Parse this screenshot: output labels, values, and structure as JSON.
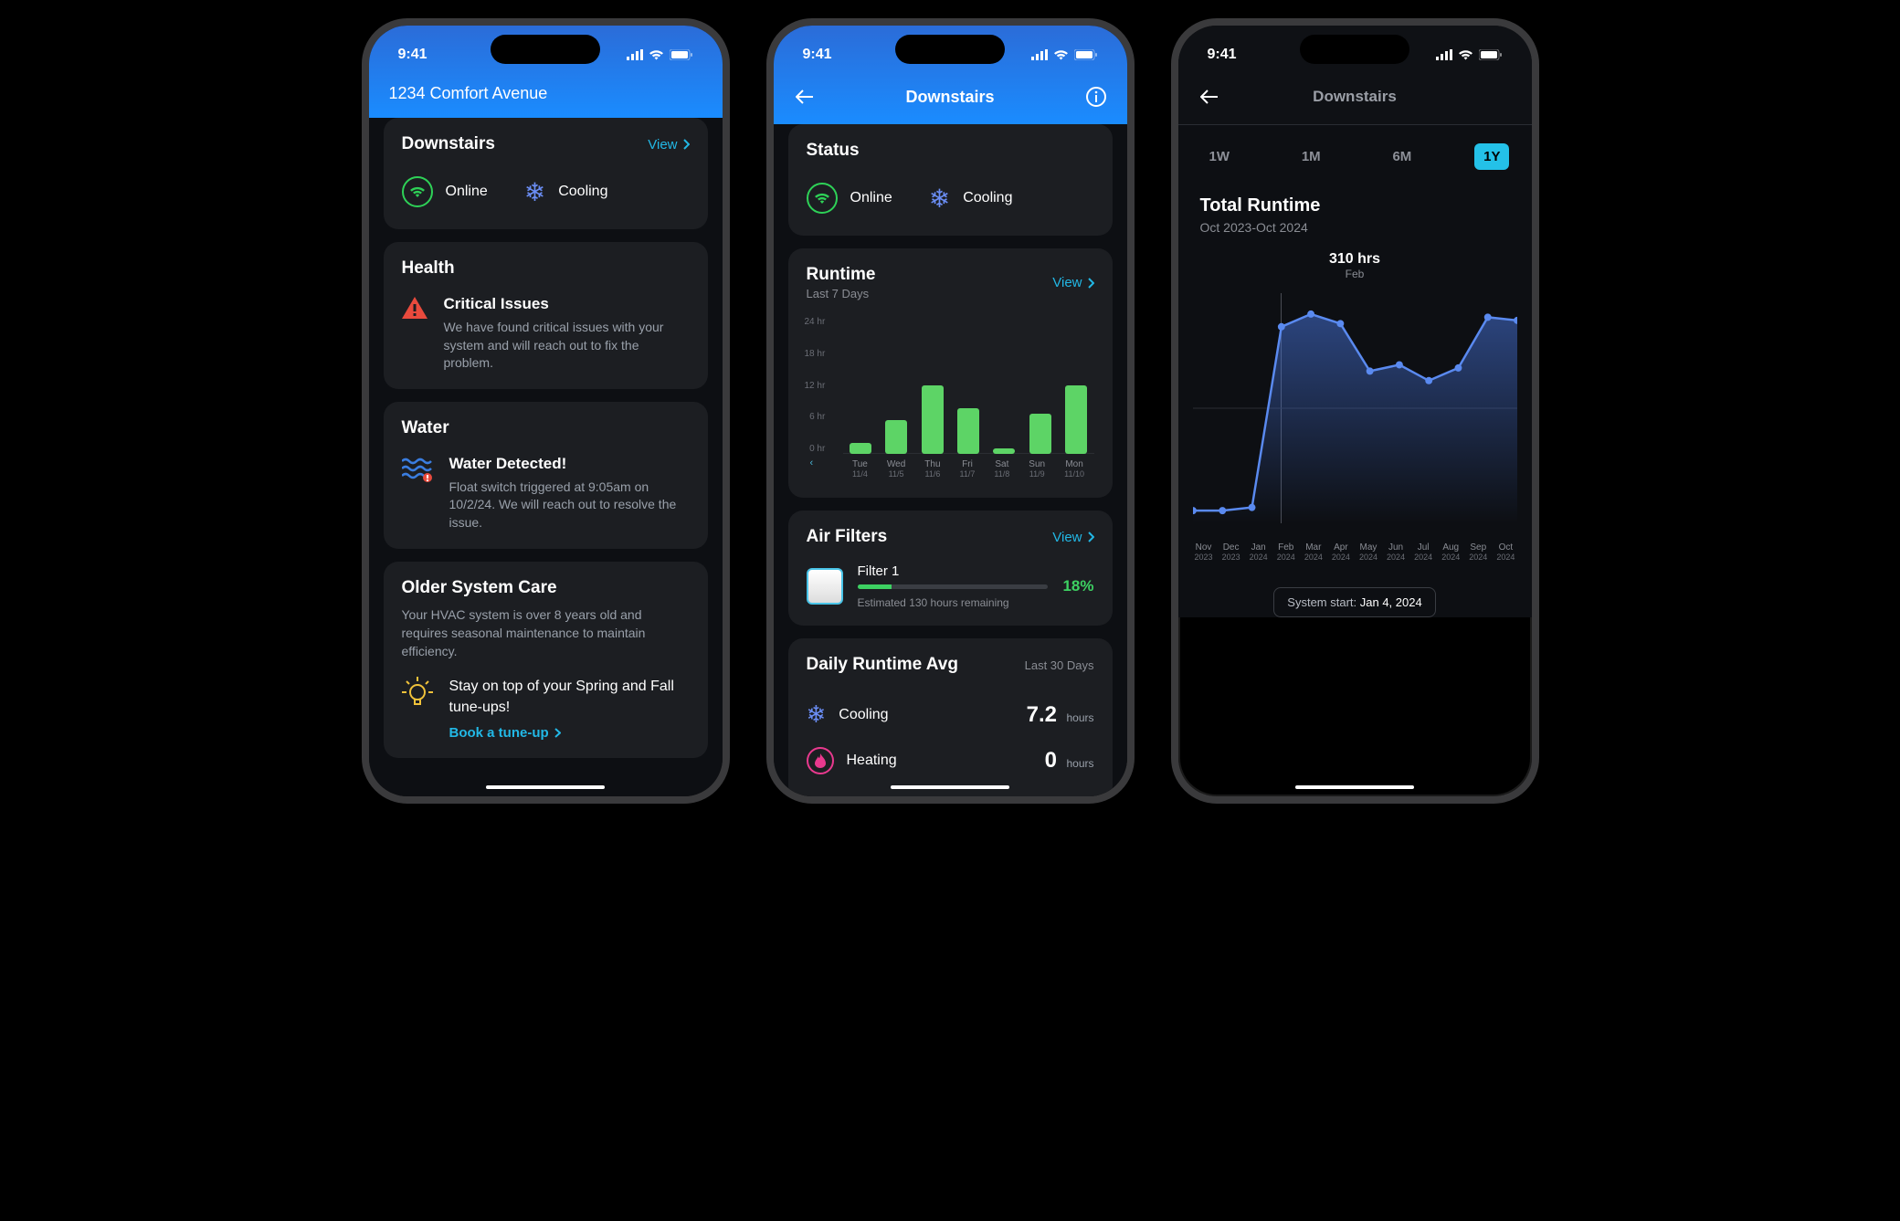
{
  "status_time": "9:41",
  "screen1": {
    "address": "1234 Comfort Avenue",
    "zone_name": "Downstairs",
    "view_label": "View",
    "status_online": "Online",
    "status_mode": "Cooling",
    "health_title": "Health",
    "health_issue_title": "Critical Issues",
    "health_issue_desc": "We have found critical issues with your system and will reach out to fix the problem.",
    "water_title": "Water",
    "water_alert_title": "Water Detected!",
    "water_alert_desc": "Float switch triggered at 9:05am on 10/2/24. We will reach out to resolve the issue.",
    "care_title": "Older System Care",
    "care_desc": "Your HVAC system is over 8 years old and requires seasonal maintenance to maintain efficiency.",
    "tip_text": "Stay on top of your Spring and Fall tune-ups!",
    "book_label": "Book a tune-up"
  },
  "screen2": {
    "title": "Downstairs",
    "status_title": "Status",
    "status_online": "Online",
    "status_mode": "Cooling",
    "runtime_title": "Runtime",
    "runtime_sub": "Last 7 Days",
    "view_label": "View",
    "filters_title": "Air Filters",
    "filter_name": "Filter 1",
    "filter_pct": "18%",
    "filter_est": "Estimated 130 hours remaining",
    "daily_title": "Daily Runtime Avg",
    "daily_sub": "Last 30 Days",
    "cooling_label": "Cooling",
    "cooling_value": "7.2",
    "cooling_unit": "hours",
    "heating_label": "Heating",
    "heating_value": "0",
    "heating_unit": "hours"
  },
  "screen3": {
    "title": "Downstairs",
    "segs": [
      "1W",
      "1M",
      "6M",
      "1Y"
    ],
    "seg_active": "1Y",
    "runtime_title": "Total Runtime",
    "runtime_range": "Oct 2023-Oct 2024",
    "tooltip_value": "310 hrs",
    "tooltip_month": "Feb",
    "system_start_label": "System start: ",
    "system_start_date": "Jan 4, 2024"
  },
  "chart_data": [
    {
      "type": "bar",
      "title": "Runtime Last 7 Days",
      "categories": [
        "Tue 11/4",
        "Wed 11/5",
        "Thu 11/6",
        "Fri 11/7",
        "Sat 11/8",
        "Sun 11/9",
        "Mon 11/10"
      ],
      "values": [
        2,
        6,
        12,
        8,
        1,
        7,
        12
      ],
      "ylabel": "hours",
      "ylim": [
        0,
        24
      ],
      "yticks": [
        "0 hr",
        "6 hr",
        "12 hr",
        "18 hr",
        "24 hr"
      ]
    },
    {
      "type": "area",
      "title": "Total Runtime Oct 2023-Oct 2024",
      "categories": [
        "Nov 2023",
        "Dec 2023",
        "Jan 2024",
        "Feb 2024",
        "Mar 2024",
        "Apr 2024",
        "May 2024",
        "Jun 2024",
        "Jul 2024",
        "Aug 2024",
        "Sep 2024",
        "Oct 2024"
      ],
      "values": [
        20,
        20,
        25,
        310,
        330,
        315,
        240,
        250,
        225,
        245,
        325,
        320
      ],
      "ylabel": "hours"
    }
  ]
}
